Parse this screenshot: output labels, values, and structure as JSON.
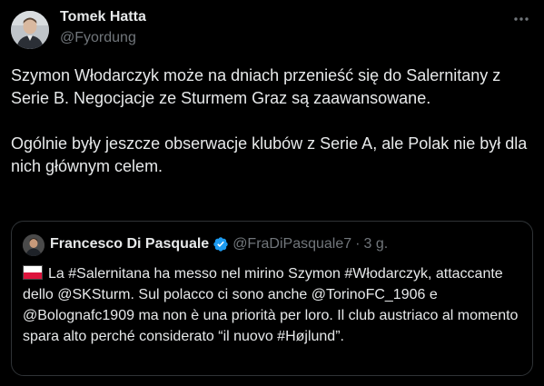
{
  "tweet": {
    "author": {
      "name": "Tomek Hatta",
      "handle": "@Fyordung"
    },
    "more_icon": "more-horizontal-icon",
    "paragraphs": [
      "Szymon Włodarczyk może na dniach przenieść się do Salernitany z Serie B. Negocjacje ze Sturmem Graz są zaawansowane.",
      "Ogólnie były jeszcze obserwacje klubów z Serie A, ale Polak nie był dla nich głównym celem."
    ]
  },
  "quote": {
    "author": {
      "name": "Francesco Di Pasquale",
      "handle": "@FraDiPasquale7",
      "separator": "·",
      "time": "3 g."
    },
    "verified_icon": "verified-badge-icon",
    "flag_icon": "poland-flag-icon",
    "text": "La #Salernitana ha messo nel mirino Szymon #Włodarczyk, attaccante dello @SKSturm. Sul polacco ci sono anche @TorinoFC_1906 e @Bolognafc1909 ma non è una priorità per loro. Il club austriaco al momento spara alto perché considerato “il nuovo #Højlund”."
  },
  "colors": {
    "background": "#000000",
    "text_primary": "#e7e9ea",
    "text_secondary": "#71767b",
    "border": "#2f3336",
    "verified": "#1d9bf0"
  }
}
